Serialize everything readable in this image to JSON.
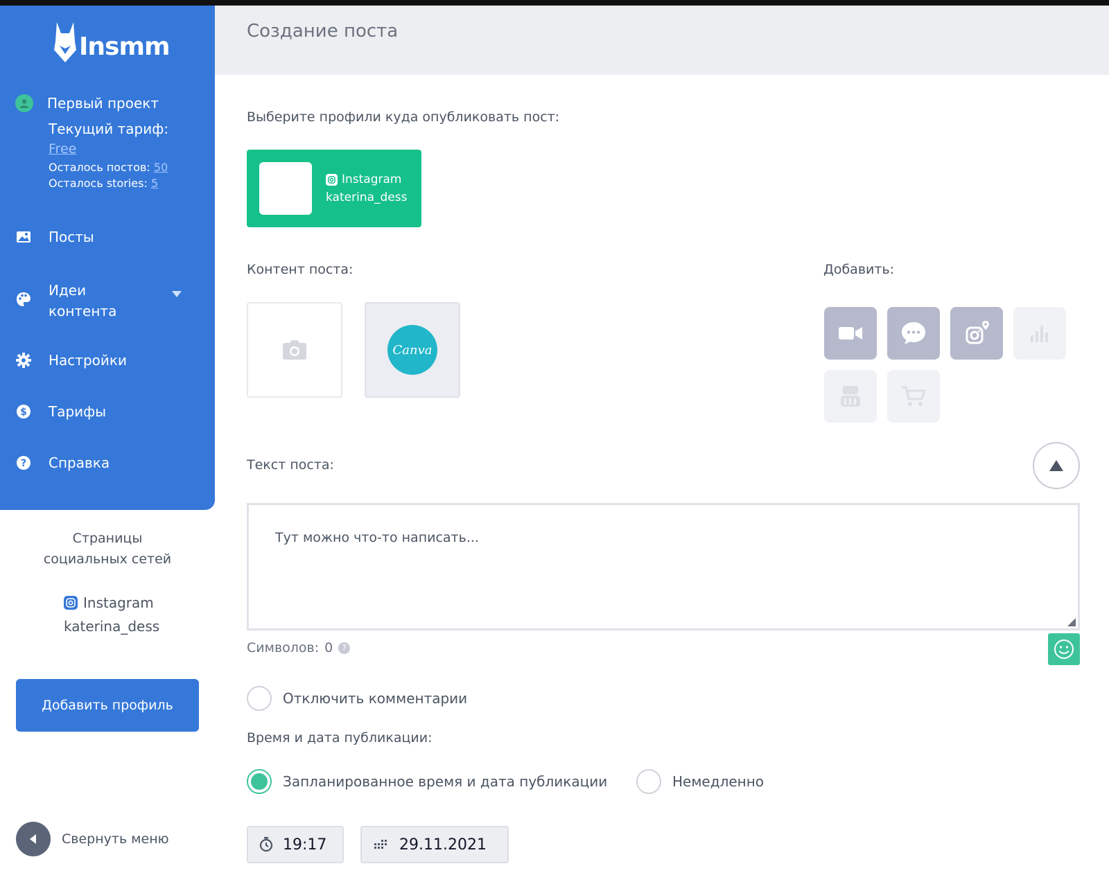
{
  "brand": {
    "logo_text": "Insmm"
  },
  "project": {
    "name": "Первый проект",
    "tariff_label": "Текущий тариф:",
    "tariff_name": "Free",
    "posts_left_label": "Осталось постов:",
    "posts_left_value": "50",
    "stories_left_label": "Осталось stories:",
    "stories_left_value": "5"
  },
  "nav": {
    "posts": "Посты",
    "ideas_line1": "Идеи",
    "ideas_line2": "контента",
    "settings": "Настройки",
    "tariffs": "Тарифы",
    "help": "Справка"
  },
  "socials": {
    "title_line1": "Страницы",
    "title_line2": "социальных сетей",
    "network": "Instagram",
    "account": "katerina_dess",
    "add_profile": "Добавить профиль"
  },
  "collapse_menu": "Свернуть меню",
  "header": {
    "title": "Создание поста"
  },
  "form": {
    "choose_profiles": "Выберите профили куда опубликовать пост:",
    "profile_card": {
      "network": "Instagram",
      "account": "katerina_dess"
    },
    "content_label": "Контент поста:",
    "add_label": "Добавить:",
    "canva_text": "Canva",
    "text_label": "Текст поста:",
    "text_placeholder": "Тут можно что-то написать...",
    "chars_label": "Символов:",
    "chars_value": "0",
    "disable_comments": "Отключить комментарии",
    "publish_time_label": "Время и дата публикации:",
    "scheduled": "Запланированное время и дата публикации",
    "immediately": "Немедленно",
    "time": "19:17",
    "date": "29.11.2021"
  },
  "colors": {
    "sidebar": "#3578d9",
    "accent_green": "#16c08a",
    "canva": "#21b6c9"
  },
  "icons": [
    "video-icon",
    "chat-icon",
    "instagram-location-icon",
    "chart-icon",
    "youtube-icon",
    "cart-icon"
  ]
}
